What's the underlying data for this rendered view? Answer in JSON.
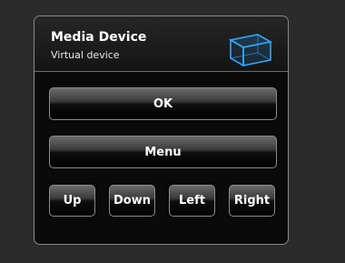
{
  "device": {
    "title": "Media Device",
    "subtitle": "Virtual device",
    "icon": "cube-icon",
    "accent_color": "#2ea8ff"
  },
  "controls": {
    "ok_label": "OK",
    "menu_label": "Menu",
    "up_label": "Up",
    "down_label": "Down",
    "left_label": "Left",
    "right_label": "Right"
  }
}
